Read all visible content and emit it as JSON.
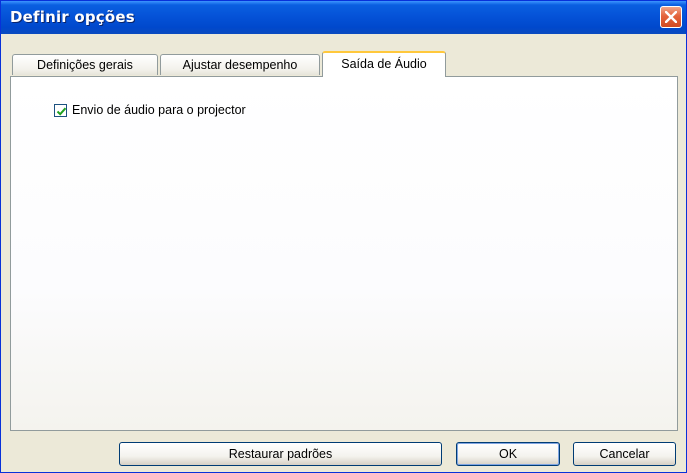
{
  "window": {
    "title": "Definir opções"
  },
  "tabs": [
    {
      "label": "Definições gerais"
    },
    {
      "label": "Ajustar desempenho"
    },
    {
      "label": "Saída de Áudio"
    }
  ],
  "panel": {
    "checkbox_label": "Envio de áudio para o projector",
    "checkbox_checked": true
  },
  "buttons": {
    "restore": "Restaurar padrões",
    "ok": "OK",
    "cancel": "Cancelar"
  },
  "icons": {
    "close": "close-icon",
    "check": "check-icon"
  },
  "colors": {
    "title_bar": "#0553d8",
    "check": "#21a121",
    "active_tab_accent": "#ffc83c"
  }
}
